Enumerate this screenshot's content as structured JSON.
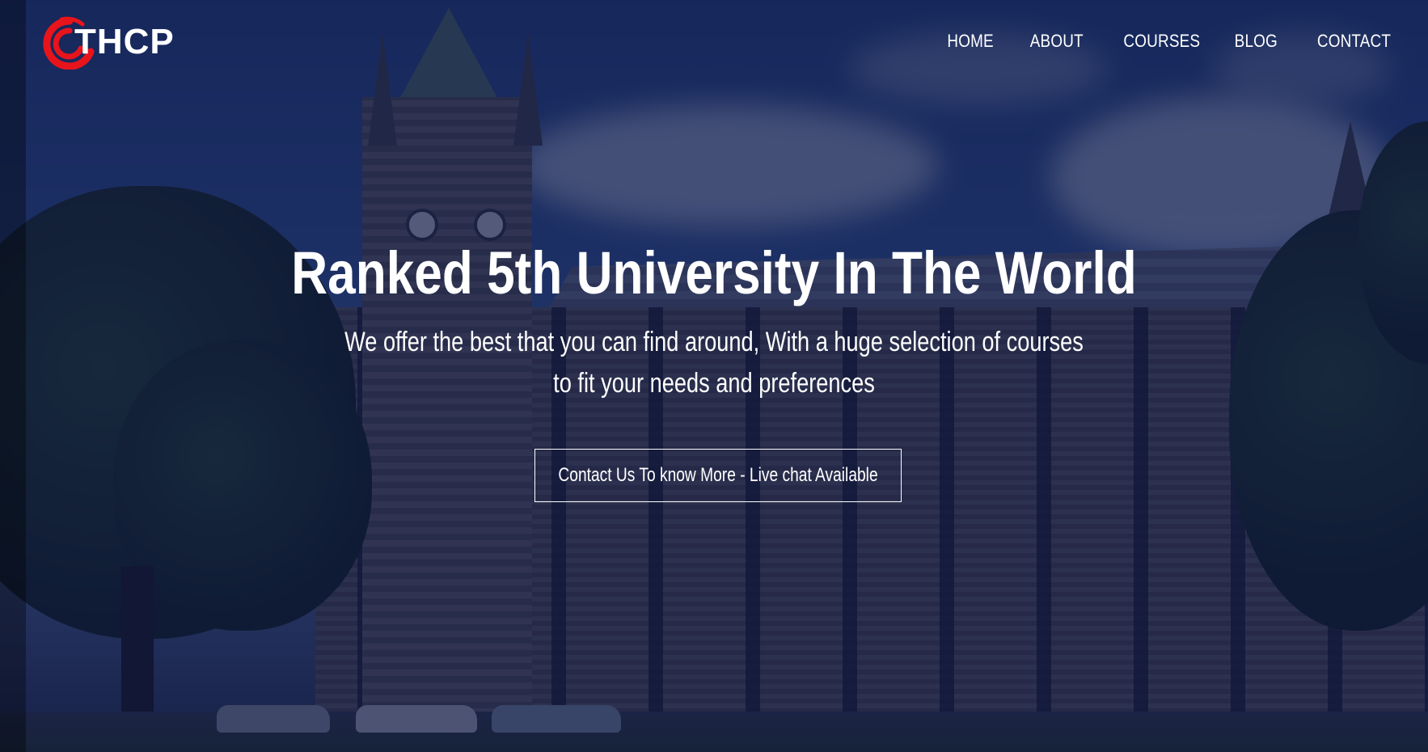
{
  "brand": {
    "name": "THCP",
    "logo_color": "#e8141c"
  },
  "nav": {
    "items": [
      {
        "label": "HOME"
      },
      {
        "label": "ABOUT"
      },
      {
        "label": "COURSES"
      },
      {
        "label": "BLOG"
      },
      {
        "label": "CONTACT"
      }
    ]
  },
  "hero": {
    "headline": "Ranked 5th University In The World",
    "subline_1": "We offer the best that you can find around, With a huge selection of courses",
    "subline_2": "to fit your needs and preferences",
    "cta_label": "Contact Us To know More - Live chat Available",
    "overlay_color": "#0e1846"
  }
}
